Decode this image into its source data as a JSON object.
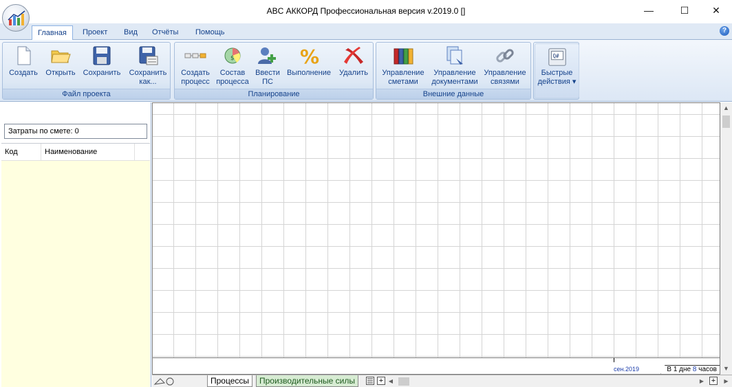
{
  "window": {
    "title": "ABC АККОРД Профессиональная версия v.2019.0 []",
    "minimize_glyph": "—",
    "maximize_glyph": "☐",
    "close_glyph": "✕"
  },
  "menu": {
    "tabs": [
      {
        "label": "Главная",
        "active": true
      },
      {
        "label": "Проект",
        "active": false
      },
      {
        "label": "Вид",
        "active": false
      },
      {
        "label": "Отчёты",
        "active": false
      },
      {
        "label": "Помощь",
        "active": false
      }
    ],
    "help_glyph": "?"
  },
  "ribbon": {
    "groups": [
      {
        "label": "Файл проекта",
        "buttons": [
          {
            "line1": "Создать",
            "line2": "",
            "icon": "new-document-icon"
          },
          {
            "line1": "Открыть",
            "line2": "",
            "icon": "open-folder-icon"
          },
          {
            "line1": "Сохранить",
            "line2": "",
            "icon": "floppy-disk-icon"
          },
          {
            "line1": "Сохранить",
            "line2": "как...",
            "icon": "save-as-icon"
          }
        ]
      },
      {
        "label": "Планирование",
        "buttons": [
          {
            "line1": "Создать",
            "line2": "процесс",
            "icon": "process-chain-icon"
          },
          {
            "line1": "Состав",
            "line2": "процесса",
            "icon": "pie-chart-icon"
          },
          {
            "line1": "Ввести",
            "line2": "ПС",
            "icon": "add-user-icon"
          },
          {
            "line1": "Выполнение",
            "line2": "",
            "icon": "percent-icon"
          },
          {
            "line1": "Удалить",
            "line2": "",
            "icon": "delete-cross-icon"
          }
        ]
      },
      {
        "label": "Внешние данные",
        "buttons": [
          {
            "line1": "Управление",
            "line2": "сметами",
            "icon": "binders-icon"
          },
          {
            "line1": "Управление",
            "line2": "документами",
            "icon": "documents-icon"
          },
          {
            "line1": "Управление",
            "line2": "связями",
            "icon": "chain-link-icon"
          }
        ]
      },
      {
        "label": "",
        "buttons": [
          {
            "line1": "Быстрые",
            "line2": "действия ▾",
            "icon": "quick-actions-icon"
          }
        ]
      }
    ]
  },
  "left_panel": {
    "cost_label": "Затраты по смете: 0",
    "columns": [
      "Код",
      "Наименование"
    ]
  },
  "timeline": {
    "month_label": "сен.2019",
    "scale_prefix": "В 1 дне ",
    "scale_value": "8",
    "scale_suffix": " часов"
  },
  "bottom_tabs": {
    "processes": "Процессы",
    "resources": "Производительные силы",
    "add_glyph": "+"
  },
  "scroll": {
    "up": "▲",
    "down": "▼",
    "left": "◀",
    "right": "▶"
  }
}
